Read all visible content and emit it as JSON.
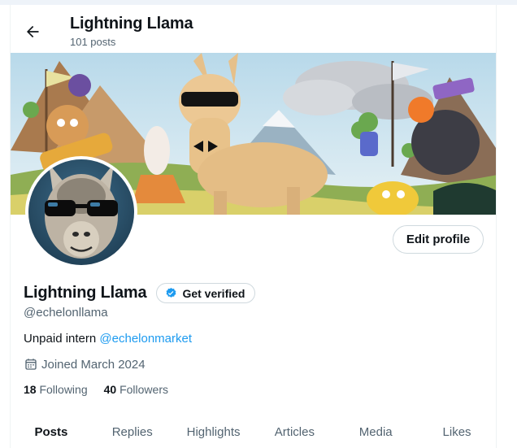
{
  "header": {
    "title": "Lightning Llama",
    "post_count": "101 posts"
  },
  "profile": {
    "display_name": "Lightning Llama",
    "handle": "@echelonllama",
    "edit_label": "Edit profile",
    "verify_label": "Get verified",
    "bio_text": "Unpaid intern ",
    "bio_mention": "@echelonmarket",
    "joined": "Joined March 2024",
    "following_count": "18",
    "following_label": "Following",
    "followers_count": "40",
    "followers_label": "Followers"
  },
  "tabs": [
    {
      "label": "Posts",
      "active": true
    },
    {
      "label": "Replies"
    },
    {
      "label": "Highlights"
    },
    {
      "label": "Articles"
    },
    {
      "label": "Media"
    },
    {
      "label": "Likes"
    }
  ],
  "colors": {
    "accent": "#1d9bf0",
    "text": "#0f1419",
    "muted": "#536471",
    "border": "#cfd9de"
  },
  "icons": {
    "back": "arrow-left-icon",
    "verified": "verified-badge-icon",
    "joined": "calendar-icon"
  }
}
